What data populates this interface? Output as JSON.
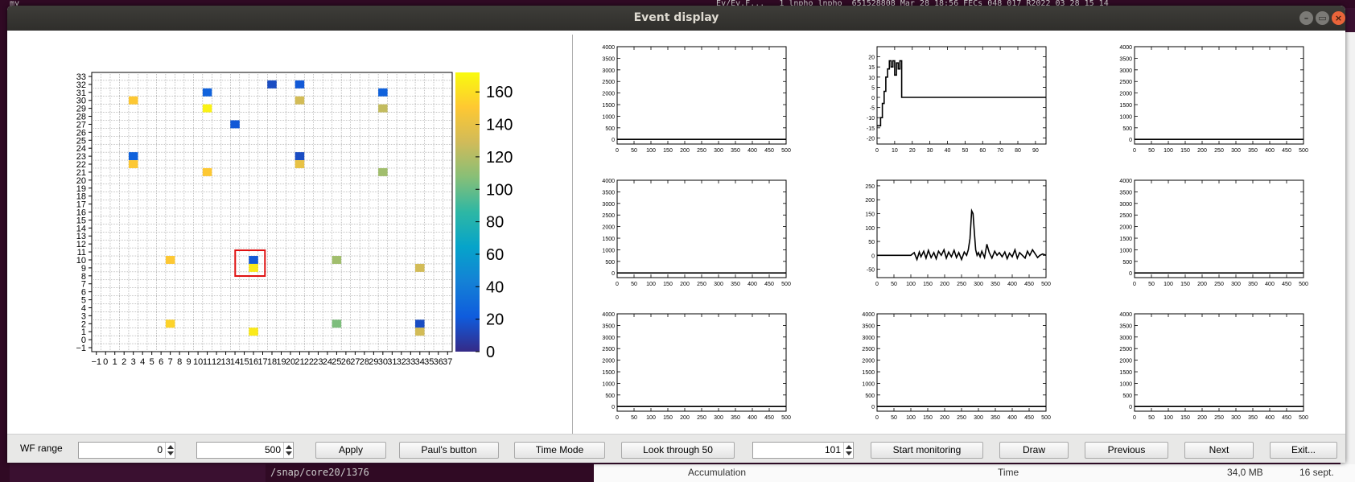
{
  "window": {
    "title": "Event display",
    "controls": {
      "minimize": "–",
      "maximize": "▭",
      "close": "×"
    }
  },
  "background": {
    "term_top_left": "my  ",
    "term_top_mid": "   Ev/Ev.F...   1 lnpho lnpho  651528808 Mar 28 18:56 FECs_048_017_R2022_03_28_15_14",
    "term_bottom": "/snap/core20/1376",
    "bottom_accumulation": "Accumulation",
    "bottom_time": "Time",
    "bottom_size": "34,0 MB",
    "bottom_date": "16 sept."
  },
  "channel_map": {
    "x_ticks": [
      "−1",
      "0",
      "1",
      "2",
      "3",
      "4",
      "5",
      "6",
      "7",
      "8",
      "9",
      "10",
      "11",
      "12",
      "13",
      "14",
      "15",
      "16",
      "17",
      "18",
      "19",
      "20",
      "21",
      "22",
      "23",
      "24",
      "25",
      "26",
      "27",
      "28",
      "29",
      "30",
      "31",
      "32",
      "33",
      "34",
      "35",
      "36",
      "37"
    ],
    "y_ticks": [
      "−1",
      "0",
      "1",
      "2",
      "3",
      "4",
      "5",
      "6",
      "7",
      "8",
      "9",
      "10",
      "11",
      "12",
      "13",
      "14",
      "15",
      "16",
      "17",
      "18",
      "19",
      "20",
      "21",
      "22",
      "23",
      "24",
      "25",
      "26",
      "27",
      "28",
      "29",
      "30",
      "31",
      "32",
      "33"
    ],
    "colorbar_ticks": [
      "0",
      "20",
      "40",
      "60",
      "80",
      "100",
      "120",
      "140",
      "160"
    ],
    "zmax": 172,
    "selected_cell": {
      "x": 16,
      "y": 10
    },
    "cells": [
      {
        "x": 3,
        "y": 30,
        "v": 150
      },
      {
        "x": 11,
        "y": 31,
        "v": 25
      },
      {
        "x": 11,
        "y": 29,
        "v": 168
      },
      {
        "x": 18,
        "y": 32,
        "v": 15
      },
      {
        "x": 21,
        "y": 32,
        "v": 20
      },
      {
        "x": 21,
        "y": 30,
        "v": 130
      },
      {
        "x": 30,
        "y": 31,
        "v": 25
      },
      {
        "x": 30,
        "y": 29,
        "v": 125
      },
      {
        "x": 14,
        "y": 27,
        "v": 20
      },
      {
        "x": 3,
        "y": 23,
        "v": 25
      },
      {
        "x": 3,
        "y": 22,
        "v": 150
      },
      {
        "x": 21,
        "y": 23,
        "v": 15
      },
      {
        "x": 21,
        "y": 22,
        "v": 140
      },
      {
        "x": 11,
        "y": 21,
        "v": 150
      },
      {
        "x": 30,
        "y": 21,
        "v": 115
      },
      {
        "x": 7,
        "y": 10,
        "v": 150
      },
      {
        "x": 16,
        "y": 10,
        "v": 20
      },
      {
        "x": 16,
        "y": 9,
        "v": 165
      },
      {
        "x": 25,
        "y": 10,
        "v": 115
      },
      {
        "x": 34,
        "y": 9,
        "v": 130
      },
      {
        "x": 7,
        "y": 2,
        "v": 155
      },
      {
        "x": 16,
        "y": 1,
        "v": 165
      },
      {
        "x": 25,
        "y": 2,
        "v": 105
      },
      {
        "x": 34,
        "y": 2,
        "v": 15
      },
      {
        "x": 34,
        "y": 1,
        "v": 130
      }
    ]
  },
  "chart_data": [
    {
      "type": "line",
      "panel": "wf-1",
      "xlim": [
        0,
        500
      ],
      "ylim": [
        -200,
        4000
      ],
      "x_ticks": [
        "0",
        "50",
        "100",
        "150",
        "200",
        "250",
        "300",
        "350",
        "400",
        "450",
        "500"
      ],
      "y_ticks": [
        "0",
        "500",
        "1000",
        "1500",
        "2000",
        "2500",
        "3000",
        "3500",
        "4000"
      ],
      "series": [
        {
          "x": [
            0,
            500
          ],
          "y": [
            0,
            0
          ]
        }
      ]
    },
    {
      "type": "line",
      "panel": "wf-2",
      "xlim": [
        0,
        96
      ],
      "ylim": [
        -23,
        25
      ],
      "x_ticks": [
        "0",
        "10",
        "20",
        "30",
        "40",
        "50",
        "60",
        "70",
        "80",
        "90"
      ],
      "y_ticks": [
        "-20",
        "-15",
        "-10",
        "-5",
        "0",
        "5",
        "10",
        "15",
        "20"
      ],
      "series": [
        {
          "x": [
            0,
            1,
            1,
            2,
            2,
            3,
            3,
            4,
            4,
            5,
            5,
            6,
            6,
            7,
            7,
            8,
            8,
            9,
            9,
            10,
            10,
            11,
            11,
            12,
            12,
            13,
            13,
            14,
            14,
            15,
            15,
            96
          ],
          "y": [
            -14,
            -14,
            -14,
            -14,
            -10,
            -10,
            -3,
            -3,
            3,
            3,
            10,
            10,
            14,
            14,
            18,
            18,
            15,
            15,
            18,
            18,
            11,
            11,
            17,
            17,
            14,
            14,
            18,
            18,
            0,
            0,
            0,
            0
          ]
        }
      ]
    },
    {
      "type": "line",
      "panel": "wf-3",
      "xlim": [
        0,
        500
      ],
      "ylim": [
        -200,
        4000
      ],
      "x_ticks": [
        "0",
        "50",
        "100",
        "150",
        "200",
        "250",
        "300",
        "350",
        "400",
        "450",
        "500"
      ],
      "y_ticks": [
        "0",
        "500",
        "1000",
        "1500",
        "2000",
        "2500",
        "3000",
        "3500",
        "4000"
      ],
      "series": [
        {
          "x": [
            0,
            500
          ],
          "y": [
            0,
            0
          ]
        }
      ]
    },
    {
      "type": "line",
      "panel": "wf-4",
      "xlim": [
        0,
        500
      ],
      "ylim": [
        -200,
        4000
      ],
      "x_ticks": [
        "0",
        "50",
        "100",
        "150",
        "200",
        "250",
        "300",
        "350",
        "400",
        "450",
        "500"
      ],
      "y_ticks": [
        "0",
        "500",
        "1000",
        "1500",
        "2000",
        "2500",
        "3000",
        "3500",
        "4000"
      ],
      "series": [
        {
          "x": [
            0,
            500
          ],
          "y": [
            0,
            0
          ]
        }
      ]
    },
    {
      "type": "line",
      "panel": "wf-5",
      "xlim": [
        0,
        500
      ],
      "ylim": [
        -80,
        270
      ],
      "x_ticks": [
        "0",
        "50",
        "100",
        "150",
        "200",
        "250",
        "300",
        "350",
        "400",
        "450",
        "500"
      ],
      "y_ticks": [
        "-50",
        "0",
        "50",
        "100",
        "150",
        "200",
        "250"
      ],
      "series": [
        {
          "x": [
            0,
            100,
            110,
            118,
            125,
            130,
            138,
            145,
            152,
            160,
            168,
            175,
            182,
            190,
            198,
            205,
            212,
            220,
            228,
            235,
            242,
            250,
            258,
            265,
            270,
            275,
            280,
            284,
            288,
            292,
            296,
            300,
            305,
            310,
            318,
            325,
            332,
            340,
            348,
            355,
            362,
            370,
            378,
            385,
            392,
            400,
            408,
            415,
            422,
            430,
            438,
            445,
            452,
            460,
            468,
            475,
            482,
            490,
            500
          ],
          "y": [
            0,
            0,
            10,
            -15,
            12,
            -5,
            15,
            -10,
            18,
            -8,
            10,
            -12,
            15,
            0,
            20,
            -10,
            12,
            -5,
            18,
            -8,
            10,
            -15,
            12,
            0,
            20,
            60,
            160,
            150,
            80,
            20,
            0,
            10,
            -5,
            15,
            -8,
            40,
            10,
            -10,
            15,
            0,
            10,
            -5,
            12,
            -12,
            8,
            -5,
            20,
            -10,
            10,
            0,
            -10,
            15,
            0,
            20,
            5,
            -8,
            0,
            5,
            0
          ]
        }
      ]
    },
    {
      "type": "line",
      "panel": "wf-6",
      "xlim": [
        0,
        500
      ],
      "ylim": [
        -200,
        4000
      ],
      "x_ticks": [
        "0",
        "50",
        "100",
        "150",
        "200",
        "250",
        "300",
        "350",
        "400",
        "450",
        "500"
      ],
      "y_ticks": [
        "0",
        "500",
        "1000",
        "1500",
        "2000",
        "2500",
        "3000",
        "3500",
        "4000"
      ],
      "series": [
        {
          "x": [
            0,
            500
          ],
          "y": [
            0,
            0
          ]
        }
      ]
    },
    {
      "type": "line",
      "panel": "wf-7",
      "xlim": [
        0,
        500
      ],
      "ylim": [
        -200,
        4000
      ],
      "x_ticks": [
        "0",
        "50",
        "100",
        "150",
        "200",
        "250",
        "300",
        "350",
        "400",
        "450",
        "500"
      ],
      "y_ticks": [
        "0",
        "500",
        "1000",
        "1500",
        "2000",
        "2500",
        "3000",
        "3500",
        "4000"
      ],
      "series": [
        {
          "x": [
            0,
            500
          ],
          "y": [
            0,
            0
          ]
        }
      ]
    },
    {
      "type": "line",
      "panel": "wf-8",
      "xlim": [
        0,
        500
      ],
      "ylim": [
        -200,
        4000
      ],
      "x_ticks": [
        "0",
        "50",
        "100",
        "150",
        "200",
        "250",
        "300",
        "350",
        "400",
        "450",
        "500"
      ],
      "y_ticks": [
        "0",
        "500",
        "1000",
        "1500",
        "2000",
        "2500",
        "3000",
        "3500",
        "4000"
      ],
      "series": [
        {
          "x": [
            0,
            500
          ],
          "y": [
            0,
            0
          ]
        }
      ]
    },
    {
      "type": "line",
      "panel": "wf-9",
      "xlim": [
        0,
        500
      ],
      "ylim": [
        -200,
        4000
      ],
      "x_ticks": [
        "0",
        "50",
        "100",
        "150",
        "200",
        "250",
        "300",
        "350",
        "400",
        "450",
        "500"
      ],
      "y_ticks": [
        "0",
        "500",
        "1000",
        "1500",
        "2000",
        "2500",
        "3000",
        "3500",
        "4000"
      ],
      "series": [
        {
          "x": [
            0,
            500
          ],
          "y": [
            0,
            0
          ]
        }
      ]
    }
  ],
  "toolbar": {
    "wf_range_label": "WF range",
    "wf_min": "0",
    "wf_max": "500",
    "apply": "Apply",
    "pauls_button": "Paul's button",
    "time_mode": "Time Mode",
    "look_through": "Look through 50",
    "event_number": "101",
    "start_monitoring": "Start monitoring",
    "draw": "Draw",
    "previous": "Previous",
    "next": "Next",
    "exit": "Exit..."
  }
}
